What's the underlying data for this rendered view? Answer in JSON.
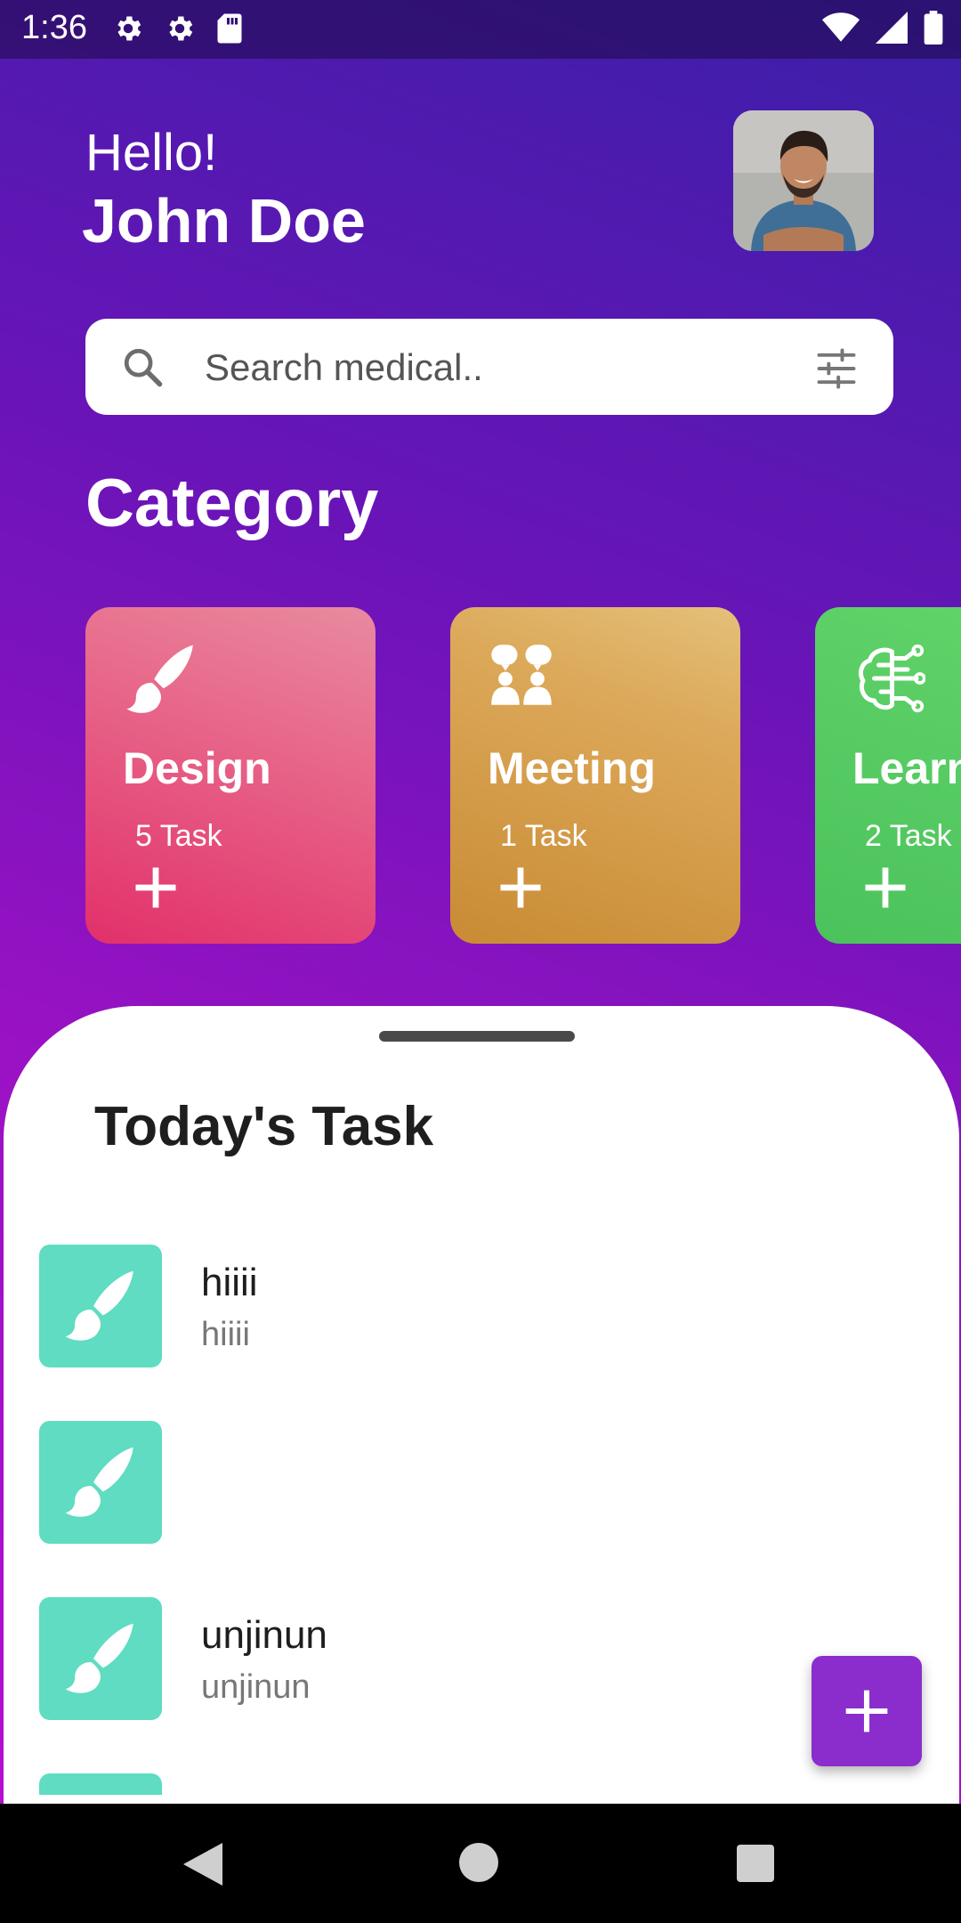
{
  "status_bar": {
    "time": "1:36",
    "left_icons": [
      "gear-icon",
      "gear-icon",
      "sd-card-icon"
    ],
    "right_icons": [
      "wifi-icon",
      "cell-signal-icon",
      "battery-icon"
    ]
  },
  "header": {
    "greeting": "Hello!",
    "user_name": "John Doe",
    "avatar": "profile-photo"
  },
  "search": {
    "placeholder": "Search medical..",
    "value": ""
  },
  "category": {
    "title": "Category",
    "cards": [
      {
        "name": "Design",
        "count": "5 Task",
        "icon": "brush-icon",
        "color": "#E2306A"
      },
      {
        "name": "Meeting",
        "count": "1 Task",
        "icon": "people-icon",
        "color": "#C98B34"
      },
      {
        "name": "Learning",
        "count": "2 Task",
        "icon": "brain-circuit-icon",
        "color": "#4CC25C"
      }
    ]
  },
  "today": {
    "title": "Today's Task",
    "tasks": [
      {
        "title": "hiiii",
        "subtitle": "hiiii",
        "icon": "brush-icon"
      },
      {
        "title": "",
        "subtitle": "",
        "icon": "brush-icon"
      },
      {
        "title": "unjinun",
        "subtitle": "unjinun",
        "icon": "brush-icon"
      },
      {
        "title": "",
        "subtitle": "",
        "icon": "brush-icon"
      }
    ]
  },
  "colors": {
    "accent": "#8B2CCC",
    "task_thumb": "#5FDCC1",
    "gradient_top": "#3A1FA8",
    "gradient_bottom": "#B50FCF"
  },
  "fab": {
    "icon": "plus-icon"
  },
  "nav": [
    "back-icon",
    "home-icon",
    "recents-icon"
  ]
}
